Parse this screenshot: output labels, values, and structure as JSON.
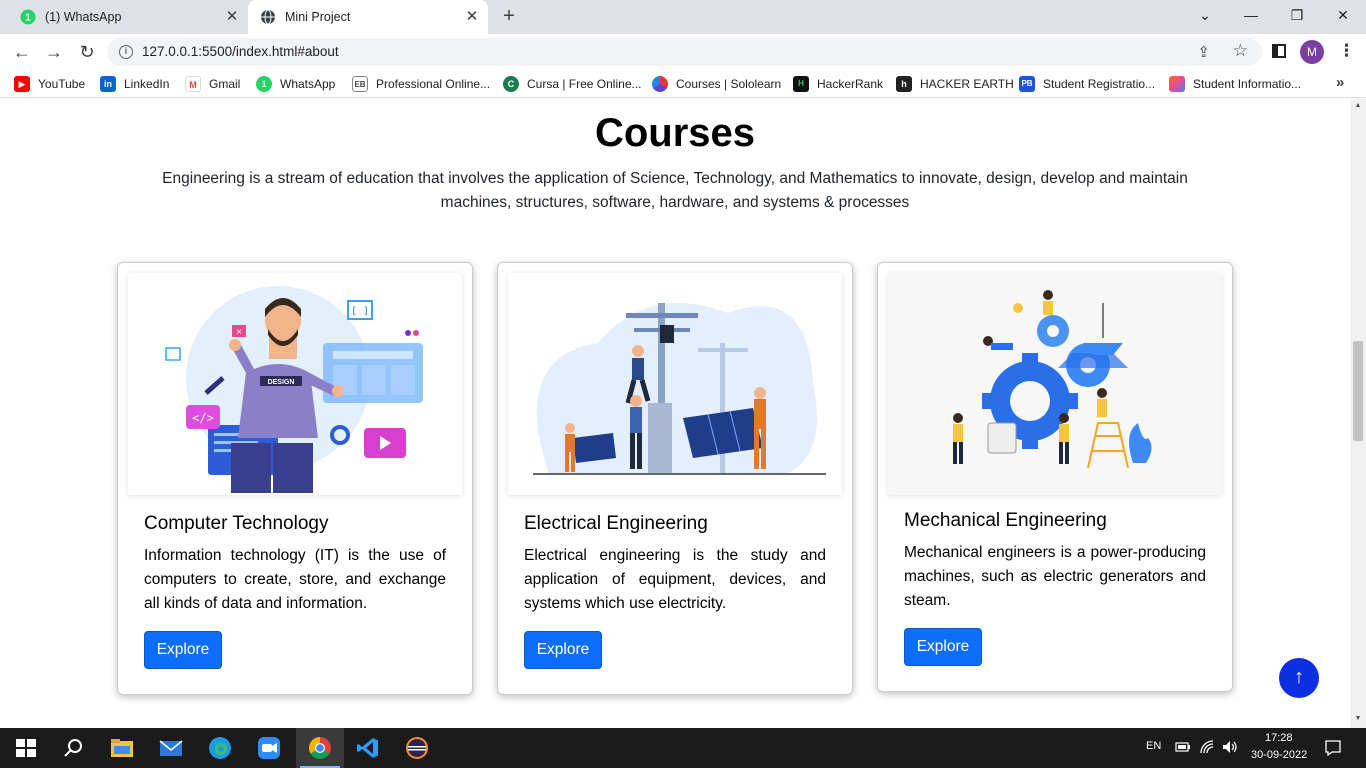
{
  "browser": {
    "tabs": [
      {
        "title": "(1) WhatsApp",
        "icon": "whatsapp-icon"
      },
      {
        "title": "Mini Project",
        "icon": "globe-icon",
        "active": true
      }
    ],
    "url": "127.0.0.1:5500/index.html#about",
    "profile_initial": "M",
    "bookmarks": [
      {
        "label": "YouTube",
        "icon": "youtube-icon",
        "color": "#ff0000"
      },
      {
        "label": "LinkedIn",
        "icon": "linkedin-icon",
        "color": "#0a66c2"
      },
      {
        "label": "Gmail",
        "icon": "gmail-icon",
        "color": "#ea4335"
      },
      {
        "label": "WhatsApp",
        "icon": "whatsapp-icon",
        "color": "#25d366"
      },
      {
        "label": "Professional Online...",
        "icon": "eb-icon",
        "color": "#444444"
      },
      {
        "label": "Cursa | Free Online...",
        "icon": "cursa-icon",
        "color": "#1a7a4c"
      },
      {
        "label": "Courses | Sololearn",
        "icon": "sololearn-icon",
        "color": "#6c3fc7"
      },
      {
        "label": "HackerRank",
        "icon": "hackerrank-icon",
        "color": "#111111"
      },
      {
        "label": "HACKER EARTH",
        "icon": "hackerearth-icon",
        "color": "#222222"
      },
      {
        "label": "Student Registratio...",
        "icon": "pb-icon",
        "color": "#1a56db"
      },
      {
        "label": "Student Informatio...",
        "icon": "student-info-icon",
        "color": "#f97316"
      }
    ]
  },
  "page": {
    "title": "Courses",
    "subtitle": "Engineering is a stream of education that involves the application of Science, Technology, and Mathematics to innovate, design, develop and maintain machines, structures, software, hardware, and systems & processes",
    "cards": [
      {
        "title": "Computer Technology",
        "text": "Information technology (IT) is the use of computers to create, store, and exchange all kinds of data and information.",
        "button": "Explore",
        "badge": "DESIGN"
      },
      {
        "title": "Electrical Engineering",
        "text": "Electrical engineering is the study and application of equipment, devices, and systems which use electricity.",
        "button": "Explore"
      },
      {
        "title": "Mechanical Engineering",
        "text": "Mechanical engineers is a power-producing machines, such as electric generators and steam.",
        "button": "Explore"
      }
    ],
    "accent_color": "#0d6efd"
  },
  "taskbar": {
    "language": "EN",
    "time": "17:28",
    "date": "30-09-2022"
  }
}
